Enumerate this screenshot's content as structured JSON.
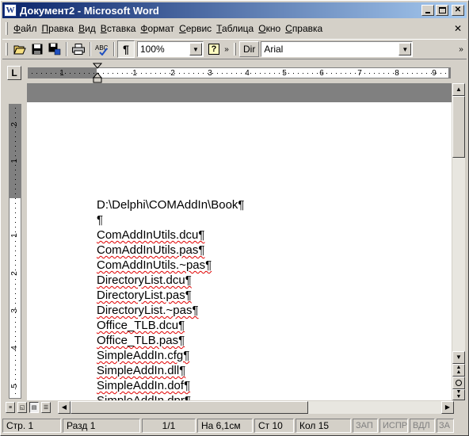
{
  "window": {
    "title": "Документ2 - Microsoft Word",
    "app_icon_letter": "W"
  },
  "menu": [
    "Файл",
    "Правка",
    "Вид",
    "Вставка",
    "Формат",
    "Сервис",
    "Таблица",
    "Окно",
    "Справка"
  ],
  "toolbar": {
    "zoom": "100%",
    "dir_label": "Dir",
    "font": "Arial",
    "pilcrow": "¶",
    "help": "?"
  },
  "ruler": {
    "horizontal_numbers": [
      "1",
      "1",
      "2",
      "3",
      "4",
      "5",
      "6",
      "7",
      "8",
      "9"
    ],
    "vertical_numbers": [
      "2",
      "1",
      "1",
      "2",
      "3",
      "4",
      "5"
    ],
    "tab_selector": "L"
  },
  "document": {
    "lines": [
      {
        "text": "D:\\Delphi\\COMAddIn\\Book¶",
        "spell": false
      },
      {
        "text": "¶",
        "spell": false
      },
      {
        "text": "ComAddInUtils.dcu¶",
        "spell": true
      },
      {
        "text": "ComAddInUtils.pas¶",
        "spell": true
      },
      {
        "text": "ComAddInUtils.~pas¶",
        "spell": true
      },
      {
        "text": "DirectoryList.dcu¶",
        "spell": true
      },
      {
        "text": "DirectoryList.pas¶",
        "spell": true
      },
      {
        "text": "DirectoryList.~pas¶",
        "spell": true
      },
      {
        "text": "Office_TLB.dcu¶",
        "spell": true
      },
      {
        "text": "Office_TLB.pas¶",
        "spell": true
      },
      {
        "text": "SimpleAddIn.cfg¶",
        "spell": true
      },
      {
        "text": "SimpleAddIn.dll¶",
        "spell": true
      },
      {
        "text": "SimpleAddIn.dof¶",
        "spell": true
      },
      {
        "text": "SimpleAddIn.dpr¶",
        "spell": true
      }
    ]
  },
  "status": {
    "page": "Стр. 1",
    "section": "Разд 1",
    "pages": "1/1",
    "at": "На 6,1см",
    "line": "Ст 10",
    "col": "Кол 15",
    "rec": "ЗАП",
    "trk": "ИСПР",
    "ext": "ВДЛ",
    "ovr": "ЗА"
  },
  "colors": {
    "title_start": "#0a246a",
    "title_end": "#a6caf0",
    "spell_error": "#e00000"
  }
}
